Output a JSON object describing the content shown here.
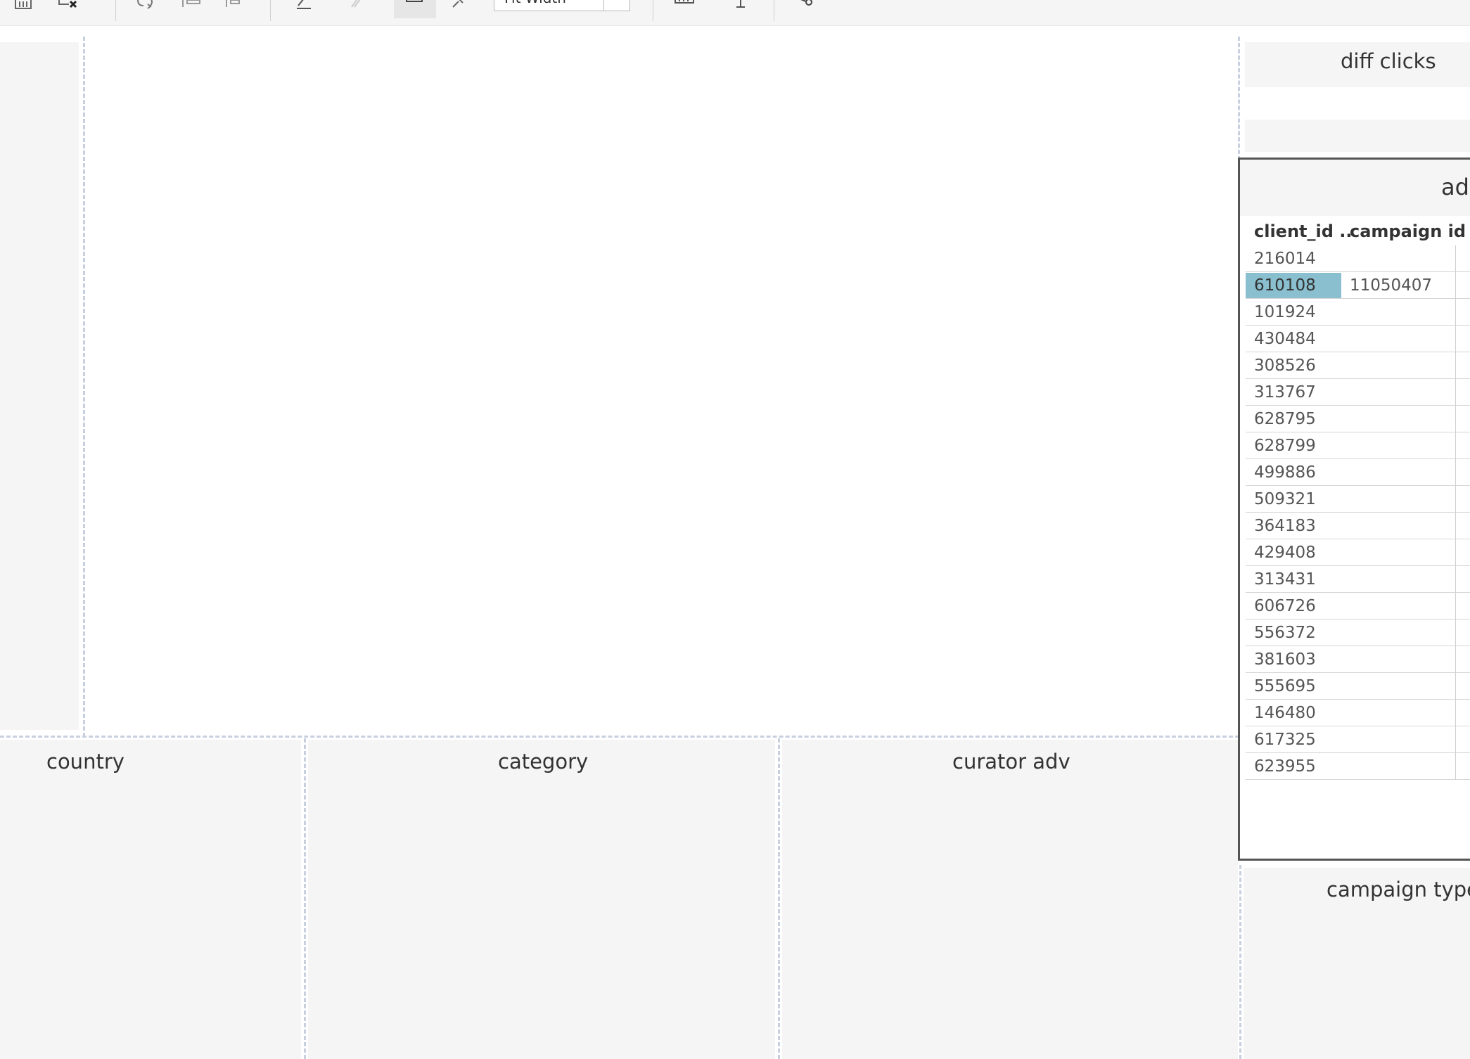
{
  "toolbar": {
    "zoom_select": "Fit Width",
    "icons": [
      "data-source-icon",
      "clear-sheet-icon",
      "swap-icon",
      "sort-ascending-icon",
      "sort-descending-icon",
      "highlight-icon",
      "group-icon",
      "show-mark-labels-icon",
      "pin-icon",
      "show-cards-icon",
      "presentation-icon",
      "share-icon"
    ]
  },
  "dashboard": {
    "diff_clicks_title": "diff clicks",
    "filters": {
      "country": "country",
      "category": "category",
      "curator_adv": "curator adv",
      "campaign_type": "campaign type"
    },
    "adv_table": {
      "title": "adv",
      "columns": [
        "client_id ..",
        "campaign id"
      ],
      "rows": [
        {
          "client_id": "216014",
          "campaign_id": ""
        },
        {
          "client_id": "610108",
          "campaign_id": "11050407",
          "selected": true
        },
        {
          "client_id": "101924",
          "campaign_id": ""
        },
        {
          "client_id": "430484",
          "campaign_id": ""
        },
        {
          "client_id": "308526",
          "campaign_id": ""
        },
        {
          "client_id": "313767",
          "campaign_id": ""
        },
        {
          "client_id": "628795",
          "campaign_id": ""
        },
        {
          "client_id": "628799",
          "campaign_id": ""
        },
        {
          "client_id": "499886",
          "campaign_id": ""
        },
        {
          "client_id": "509321",
          "campaign_id": ""
        },
        {
          "client_id": "364183",
          "campaign_id": ""
        },
        {
          "client_id": "429408",
          "campaign_id": ""
        },
        {
          "client_id": "313431",
          "campaign_id": ""
        },
        {
          "client_id": "606726",
          "campaign_id": ""
        },
        {
          "client_id": "556372",
          "campaign_id": ""
        },
        {
          "client_id": "381603",
          "campaign_id": ""
        },
        {
          "client_id": "555695",
          "campaign_id": ""
        },
        {
          "client_id": "146480",
          "campaign_id": ""
        },
        {
          "client_id": "617325",
          "campaign_id": ""
        },
        {
          "client_id": "623955",
          "campaign_id": ""
        }
      ],
      "selection_color": "#89bfcf"
    }
  }
}
